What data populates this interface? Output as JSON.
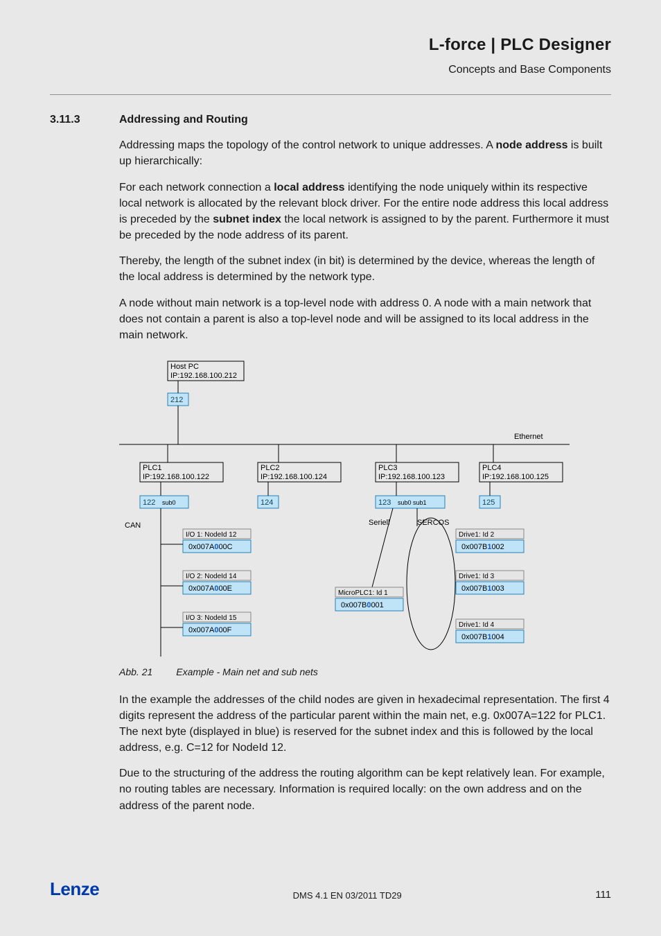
{
  "header": {
    "title": "L-force | PLC Designer",
    "subtitle": "Concepts and Base Components"
  },
  "section": {
    "number": "3.11.3",
    "title": "Addressing and Routing"
  },
  "para": {
    "p1a": "Addressing maps the topology of the control network to unique addresses.  A ",
    "p1b": "node address",
    "p1c": " is built up hierarchically:",
    "p2a": " For each network connection a ",
    "p2b": "local address",
    "p2c": " identifying the node uniquely within its respective local network is allocated by the relevant block driver. For the entire node address this local address is preceded by the ",
    "p2d": "subnet index",
    "p2e": " the local network is assigned to by the parent. Furthermore it must be preceded by the node address of its parent.",
    "p3": "Thereby, the length of the subnet index (in bit) is determined by the device, whereas the length of the local address is determined by the network type.",
    "p4": "A node without main network is a top-level node with address 0. A node with a main network that does not contain a parent is also a top-level node and will be assigned to its local address in the main network.",
    "p5": "In the example the addresses of the child nodes are given in hexadecimal representation. The first 4 digits represent the address of the particular parent within the main net, e.g. 0x007A=122 for PLC1. The next byte (displayed in blue) is reserved for the subnet index and this is followed by the local address, e.g. C=12 for NodeId 12.",
    "p6": "Due to the structuring of the address  the routing algorithm can be kept relatively lean. For example, no routing tables are necessary. Information is required locally:  on the own address and on the address of the parent node."
  },
  "fig": {
    "host_l1": "Host PC",
    "host_l2": "IP:192.168.100.212",
    "host_addr": "212",
    "eth": "Ethernet",
    "can": "CAN",
    "seriell": "Seriell",
    "sercos": "SERCOS",
    "plc1_l1": "PLC1",
    "plc1_l2": "IP:192.168.100.122",
    "plc1_addr": "122",
    "plc1_sub": "sub0",
    "plc2_l1": "PLC2",
    "plc2_l2": "IP:192.168.100.124",
    "plc2_addr": "124",
    "plc3_l1": "PLC3",
    "plc3_l2": "IP:192.168.100.123",
    "plc3_addr": "123",
    "plc3_sub": "sub0  sub1",
    "plc4_l1": "PLC4",
    "plc4_l2": "IP:192.168.100.125",
    "plc4_addr": "125",
    "io1_t": "I/O 1: NodeId 12",
    "io1_a1": "0x007A",
    "io1_a2": "0",
    "io1_a3": "00C",
    "io2_t": "I/O 2: NodeId 14",
    "io2_a1": "0x007A",
    "io2_a2": "0",
    "io2_a3": "00E",
    "io3_t": "I/O 3: NodeId 15",
    "io3_a1": "0x007A",
    "io3_a2": "0",
    "io3_a3": "00F",
    "mp_t": "MicroPLC1: Id 1",
    "mp_a1": "0x007B",
    "mp_a2": "0",
    "mp_a3": "001",
    "d1_t": "Drive1: Id 2",
    "d1_a1": "0x007B",
    "d1_a2": "1",
    "d1_a3": "002",
    "d2_t": "Drive1: Id 3",
    "d2_a1": "0x007B",
    "d2_a2": "1",
    "d2_a3": "003",
    "d3_t": "Drive1: Id 4",
    "d3_a1": "0x007B",
    "d3_a2": "1",
    "d3_a3": "004"
  },
  "caption": {
    "num": "Abb. 21",
    "text": "Example - Main net and sub nets"
  },
  "footer": {
    "brand": "Lenze",
    "mid": "DMS 4.1 EN 03/2011 TD29",
    "page": "111"
  }
}
